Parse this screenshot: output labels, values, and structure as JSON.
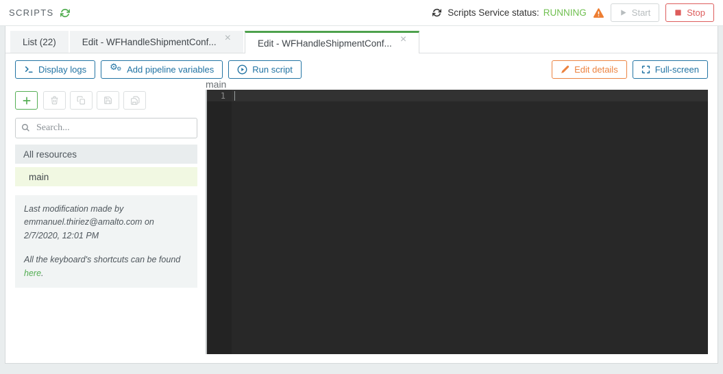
{
  "colors": {
    "accent_blue": "#2173a3",
    "green": "#54ae53",
    "status_green": "#6fbf4f",
    "orange": "#ec8340",
    "warning_orange": "#ed7d31",
    "red": "#dd5c5b",
    "tab_active_border": "#4da14c",
    "editor_bg": "#282828"
  },
  "header": {
    "title": "SCRIPTS",
    "service_status_label": "Scripts Service status:",
    "service_status_value": "RUNNING",
    "start_button": "Start",
    "stop_button": "Stop",
    "icons": [
      "refresh-icon",
      "warning-icon",
      "play-icon",
      "stop-icon"
    ]
  },
  "tabs": [
    {
      "label": "List (22)",
      "active": false
    },
    {
      "label": "Edit - WFHandleShipmentConf...",
      "close": "×",
      "active": false
    },
    {
      "label": "Edit - WFHandleShipmentConf...",
      "close": "×",
      "active": true
    }
  ],
  "toolbar": {
    "display_logs": {
      "label": "Display logs",
      "icon": "terminal-icon"
    },
    "add_pipeline_variables": {
      "label": "Add pipeline variables",
      "icon": "gears-icon",
      "gear_glyph": "⚙"
    },
    "run_script": {
      "label": "Run script",
      "icon": "play-circle-icon"
    },
    "edit_details": {
      "label": "Edit details",
      "icon": "pencil-icon"
    },
    "fullscreen": {
      "label": "Full-screen",
      "icon": "fullscreen-icon"
    }
  },
  "resource_panel": {
    "actions": [
      "add",
      "delete",
      "copy",
      "save",
      "save-all"
    ],
    "search_placeholder": "Search...",
    "group_label": "All resources",
    "resources": [
      {
        "name": "main",
        "selected": true
      }
    ],
    "last_modification": "Last modification made by emmanuel.thiriez@amalto.com on 2/7/2020, 12:01 PM",
    "shortcuts_text": "All the keyboard's shortcuts can be found ",
    "shortcuts_link": "here",
    "shortcuts_suffix": "."
  },
  "editor": {
    "resource_label": "main",
    "lines": [
      {
        "number": "1",
        "content": ""
      }
    ]
  }
}
